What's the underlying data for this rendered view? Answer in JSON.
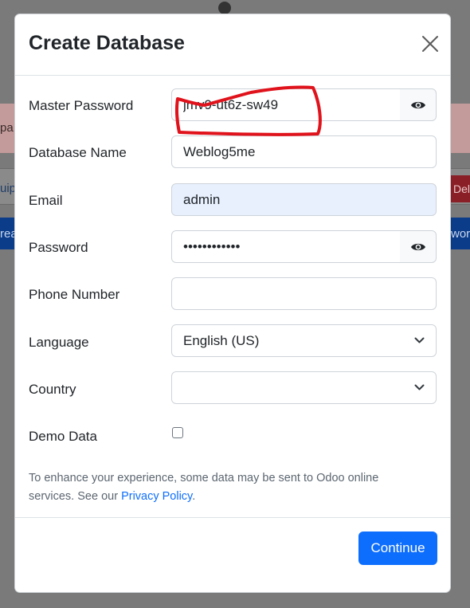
{
  "background": {
    "alert_fragment": "pa",
    "row_left_fragment": "uip",
    "delete_fragment": "Del",
    "bar_left_fragment": "rea",
    "bar_right_fragment": "word"
  },
  "modal": {
    "title": "Create Database",
    "fields": {
      "master_password": {
        "label": "Master Password",
        "value": "jmv9-ut6z-sw49"
      },
      "database_name": {
        "label": "Database Name",
        "value": "Weblog5me"
      },
      "email": {
        "label": "Email",
        "value": "admin"
      },
      "password": {
        "label": "Password",
        "value": "adminpasswd1"
      },
      "phone": {
        "label": "Phone Number",
        "value": ""
      },
      "language": {
        "label": "Language",
        "value": "English (US)"
      },
      "country": {
        "label": "Country",
        "value": ""
      },
      "demo_data": {
        "label": "Demo Data",
        "checked": false
      }
    },
    "notice_text": "To enhance your experience, some data may be sent to Odoo online services. See our ",
    "privacy_link": "Privacy Policy",
    "notice_end": ".",
    "continue_label": "Continue"
  },
  "icons": {
    "close": "close-icon",
    "eye": "eye-icon",
    "chevron": "chevron-down-icon"
  },
  "colors": {
    "primary": "#0d6efd",
    "annotation": "#e0121b",
    "autofill": "#e8f0fe"
  }
}
